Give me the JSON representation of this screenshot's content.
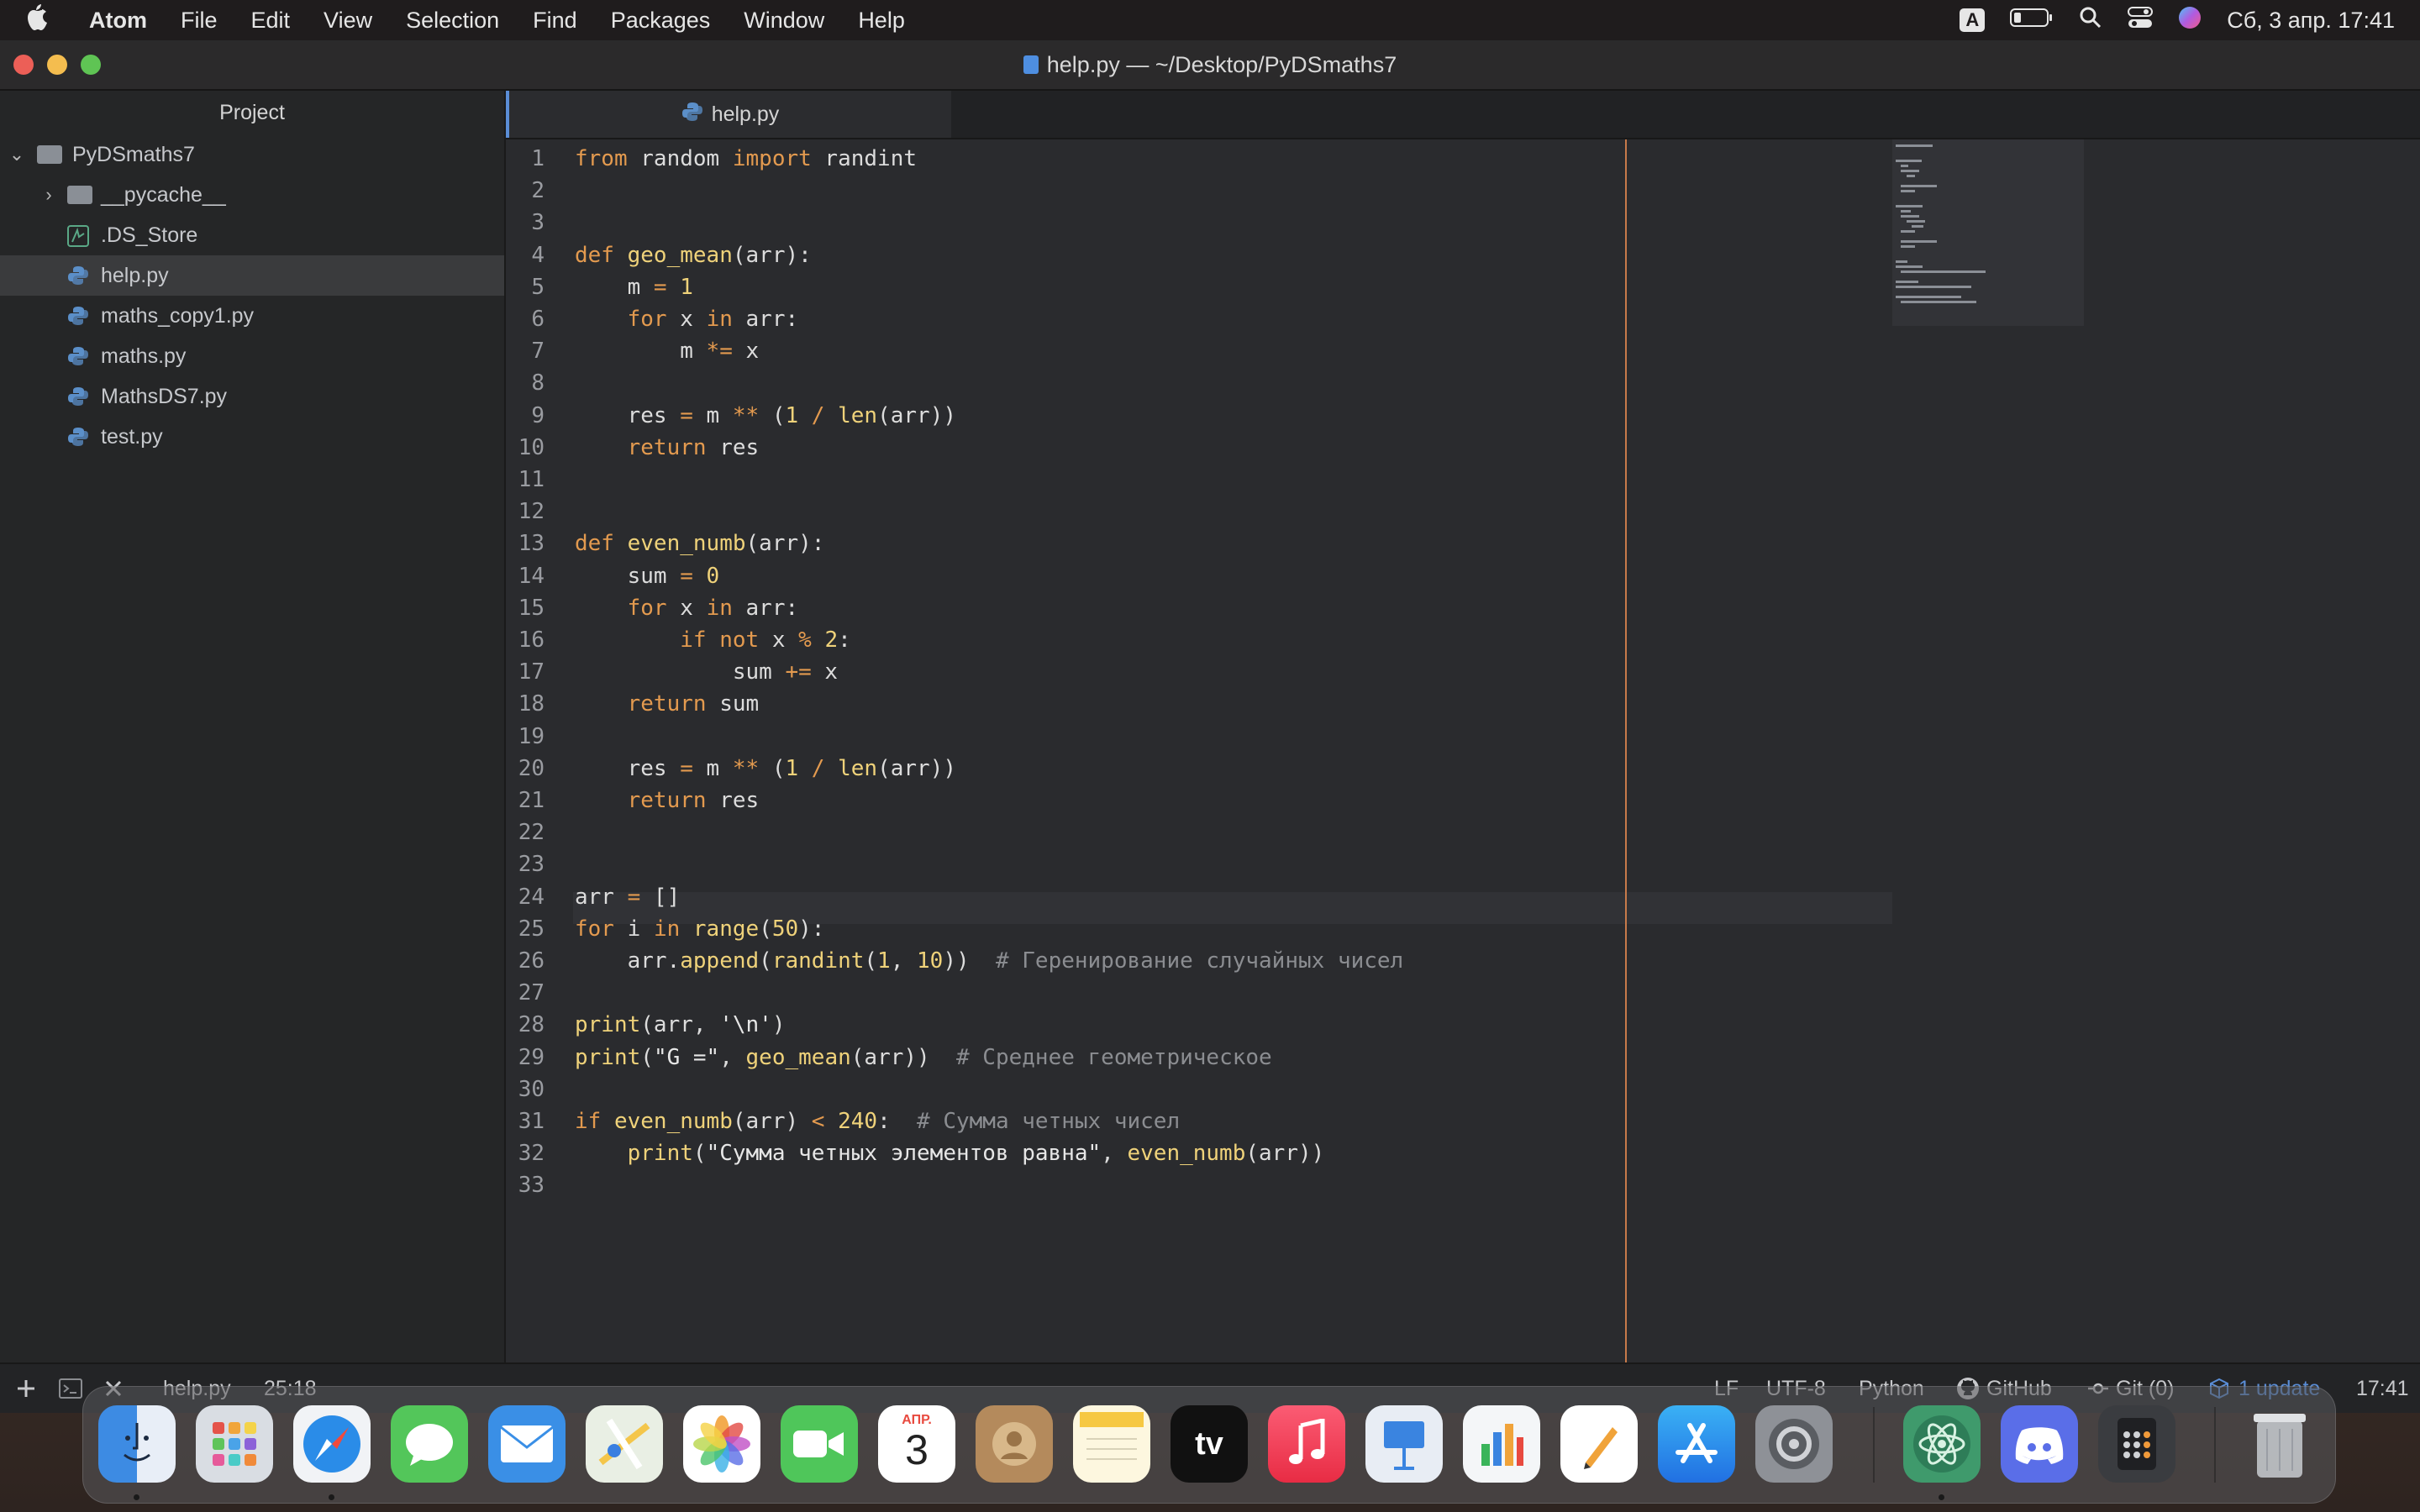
{
  "menubar": {
    "app": "Atom",
    "items": [
      "File",
      "Edit",
      "View",
      "Selection",
      "Find",
      "Packages",
      "Window",
      "Help"
    ],
    "input_source": "A",
    "datetime": "Сб, 3 апр.  17:41"
  },
  "window": {
    "title": "help.py — ~/Desktop/PyDSmaths7"
  },
  "sidebar": {
    "header": "Project",
    "root": "PyDSmaths7",
    "items": [
      {
        "label": "__pycache__",
        "type": "folder"
      },
      {
        "label": ".DS_Store",
        "type": "file"
      },
      {
        "label": "help.py",
        "type": "python"
      },
      {
        "label": "maths_copy1.py",
        "type": "python"
      },
      {
        "label": "maths.py",
        "type": "python"
      },
      {
        "label": "MathsDS7.py",
        "type": "python"
      },
      {
        "label": "test.py",
        "type": "python"
      }
    ]
  },
  "tabs": [
    {
      "label": "help.py",
      "active": true
    }
  ],
  "editor": {
    "lines": [
      "from random import randint",
      "",
      "",
      "def geo_mean(arr):",
      "    m = 1",
      "    for x in arr:",
      "        m *= x",
      "",
      "    res = m ** (1 / len(arr))",
      "    return res",
      "",
      "",
      "def even_numb(arr):",
      "    sum = 0",
      "    for x in arr:",
      "        if not x % 2:",
      "            sum += x",
      "    return sum",
      "",
      "    res = m ** (1 / len(arr))",
      "    return res",
      "",
      "",
      "arr = []",
      "for i in range(50):",
      "    arr.append(randint(1, 10))  # Геренирование случайных чисел",
      "",
      "print(arr, '\\n')",
      "print(\"G =\", geo_mean(arr))  # Среднее геометрическое",
      "",
      "if even_numb(arr) < 240:  # Сумма четных чисел",
      "    print(\"Сумма четных элементов равна\", even_numb(arr))",
      ""
    ]
  },
  "statusbar": {
    "file": "help.py",
    "cursor": "25:18",
    "line_ending": "LF",
    "encoding": "UTF-8",
    "grammar": "Python",
    "github": "GitHub",
    "git": "Git (0)",
    "update": "1 update",
    "time": "17:41"
  },
  "dock": {
    "calendar_month": "АПР.",
    "calendar_day": "3",
    "tv_label": "tv",
    "apps": [
      "Finder",
      "Launchpad",
      "Safari",
      "Messages",
      "Mail",
      "Maps",
      "Photos",
      "FaceTime",
      "Calendar",
      "Contacts",
      "Notes",
      "TV",
      "Music",
      "Keynote",
      "Numbers",
      "Pages",
      "App Store",
      "System Preferences",
      "Atom",
      "Discord",
      "Calculator",
      "Trash"
    ]
  },
  "colors": {
    "keyword": "#e39a4f",
    "function": "#efd27a",
    "comment": "#8b8d91",
    "wrap_guide": "#c77a4a",
    "accent": "#5a8dd6"
  }
}
